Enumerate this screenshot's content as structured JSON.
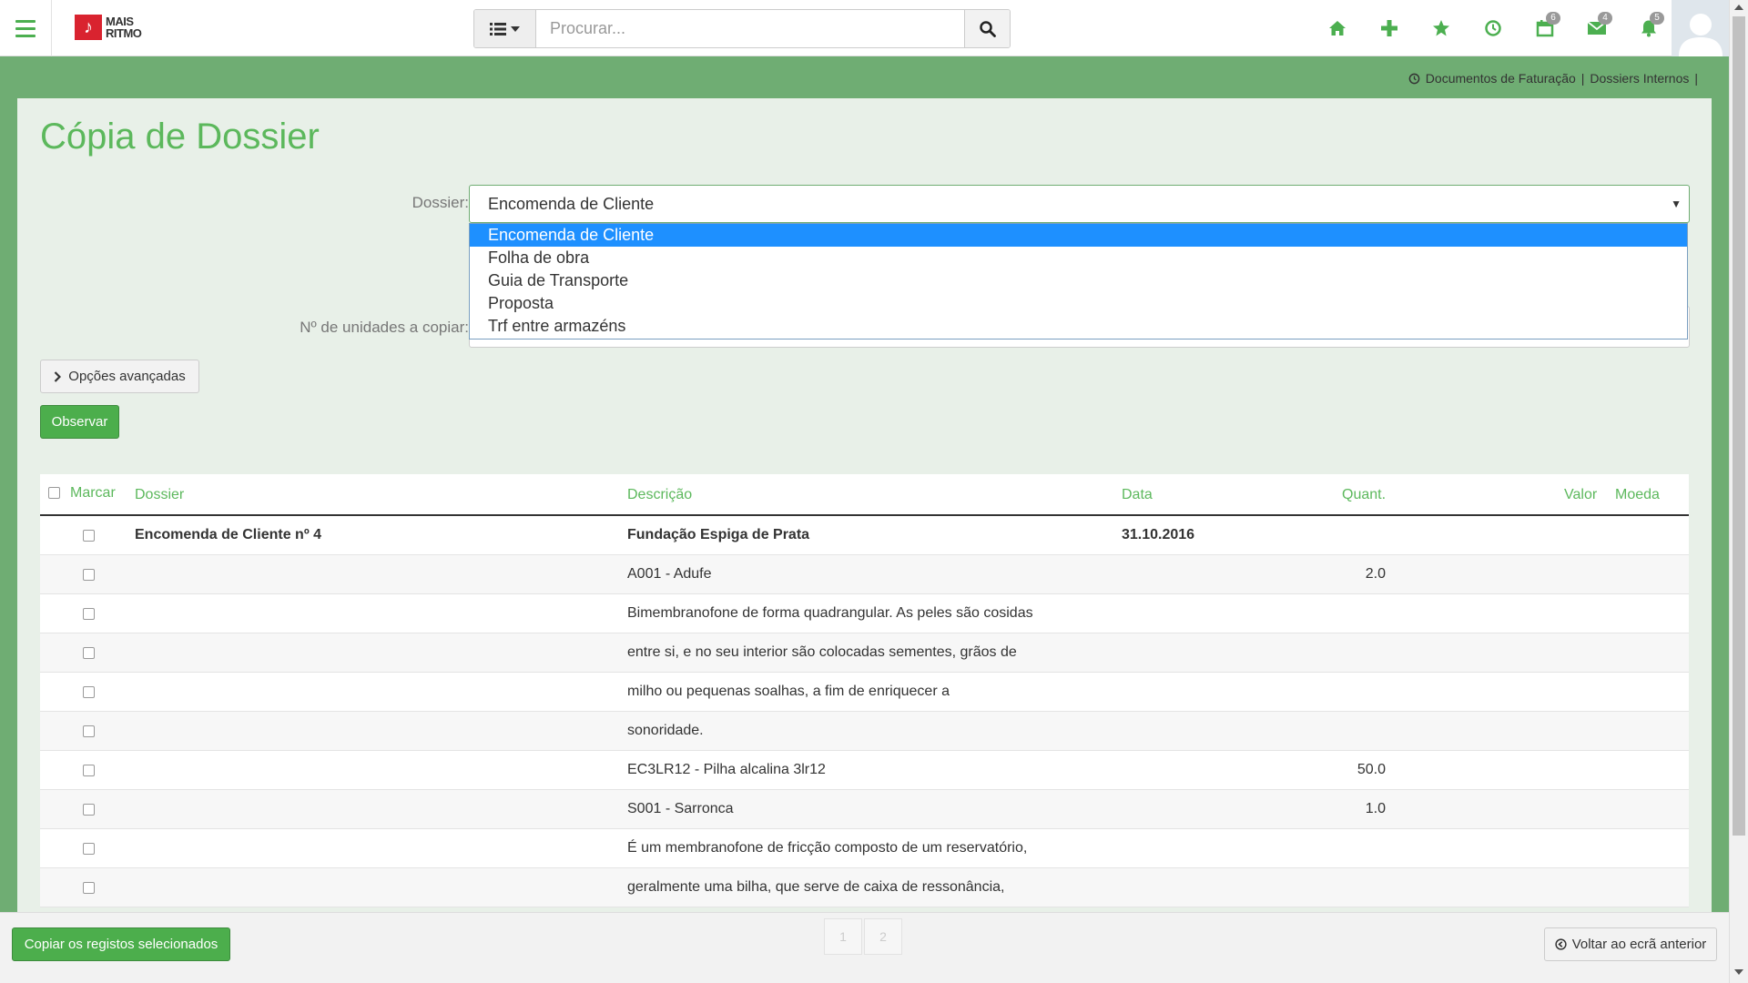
{
  "header": {
    "logo_text_line1": "MAIS",
    "logo_text_line2": "RITMO",
    "search_placeholder": "Procurar...",
    "badges": {
      "calendar": "6",
      "mail": "4",
      "bell": "5"
    }
  },
  "breadcrumb": {
    "item1": "Documentos de Faturação",
    "item2": "Dossiers Internos",
    "sep": "|"
  },
  "page": {
    "title": "Cópia de Dossier"
  },
  "form": {
    "dossier_label": "Dossier:",
    "dossier_value": "Encomenda de Cliente",
    "qty_label": "Nº de unidades a copiar:",
    "dropdown_options": [
      "Encomenda de Cliente",
      "Folha de obra",
      "Guia de Transporte",
      "Proposta",
      "Trf entre armazéns"
    ]
  },
  "buttons": {
    "advanced": "Opções avançadas",
    "observe": "Observar",
    "copy_selected": "Copiar os registos selecionados",
    "back": "Voltar ao ecrã anterior"
  },
  "table": {
    "headers": {
      "mark": "Marcar",
      "dossier": "Dossier",
      "description": "Descrição",
      "date": "Data",
      "qty": "Quant.",
      "value": "Valor",
      "currency": "Moeda"
    },
    "rows": [
      {
        "dossier": "Encomenda de Cliente nº 4",
        "description": "Fundação Espiga de Prata",
        "date": "31.10.2016",
        "qty": ""
      },
      {
        "dossier": "",
        "description": "A001 - Adufe",
        "date": "",
        "qty": "2.0"
      },
      {
        "dossier": "",
        "description": "Bimembranofone de forma quadrangular. As peles são cosidas",
        "date": "",
        "qty": ""
      },
      {
        "dossier": "",
        "description": "entre si, e no seu interior são colocadas sementes, grãos de",
        "date": "",
        "qty": ""
      },
      {
        "dossier": "",
        "description": "milho ou pequenas soalhas, a fim de enriquecer a",
        "date": "",
        "qty": ""
      },
      {
        "dossier": "",
        "description": "sonoridade.",
        "date": "",
        "qty": ""
      },
      {
        "dossier": "",
        "description": "EC3LR12 - Pilha alcalina 3lr12",
        "date": "",
        "qty": "50.0"
      },
      {
        "dossier": "",
        "description": "S001 - Sarronca",
        "date": "",
        "qty": "1.0"
      },
      {
        "dossier": "",
        "description": "É um membranofone de fricção composto de um reservatório,",
        "date": "",
        "qty": ""
      },
      {
        "dossier": "",
        "description": "geralmente uma bilha, que serve de caixa de ressonância,",
        "date": "",
        "qty": ""
      }
    ]
  },
  "pager": {
    "page1": "1",
    "page2": "2"
  },
  "colors": {
    "accent": "#4caf50",
    "background": "#6fad73",
    "panel": "#e8f0e8",
    "selected": "#1e90ff"
  }
}
